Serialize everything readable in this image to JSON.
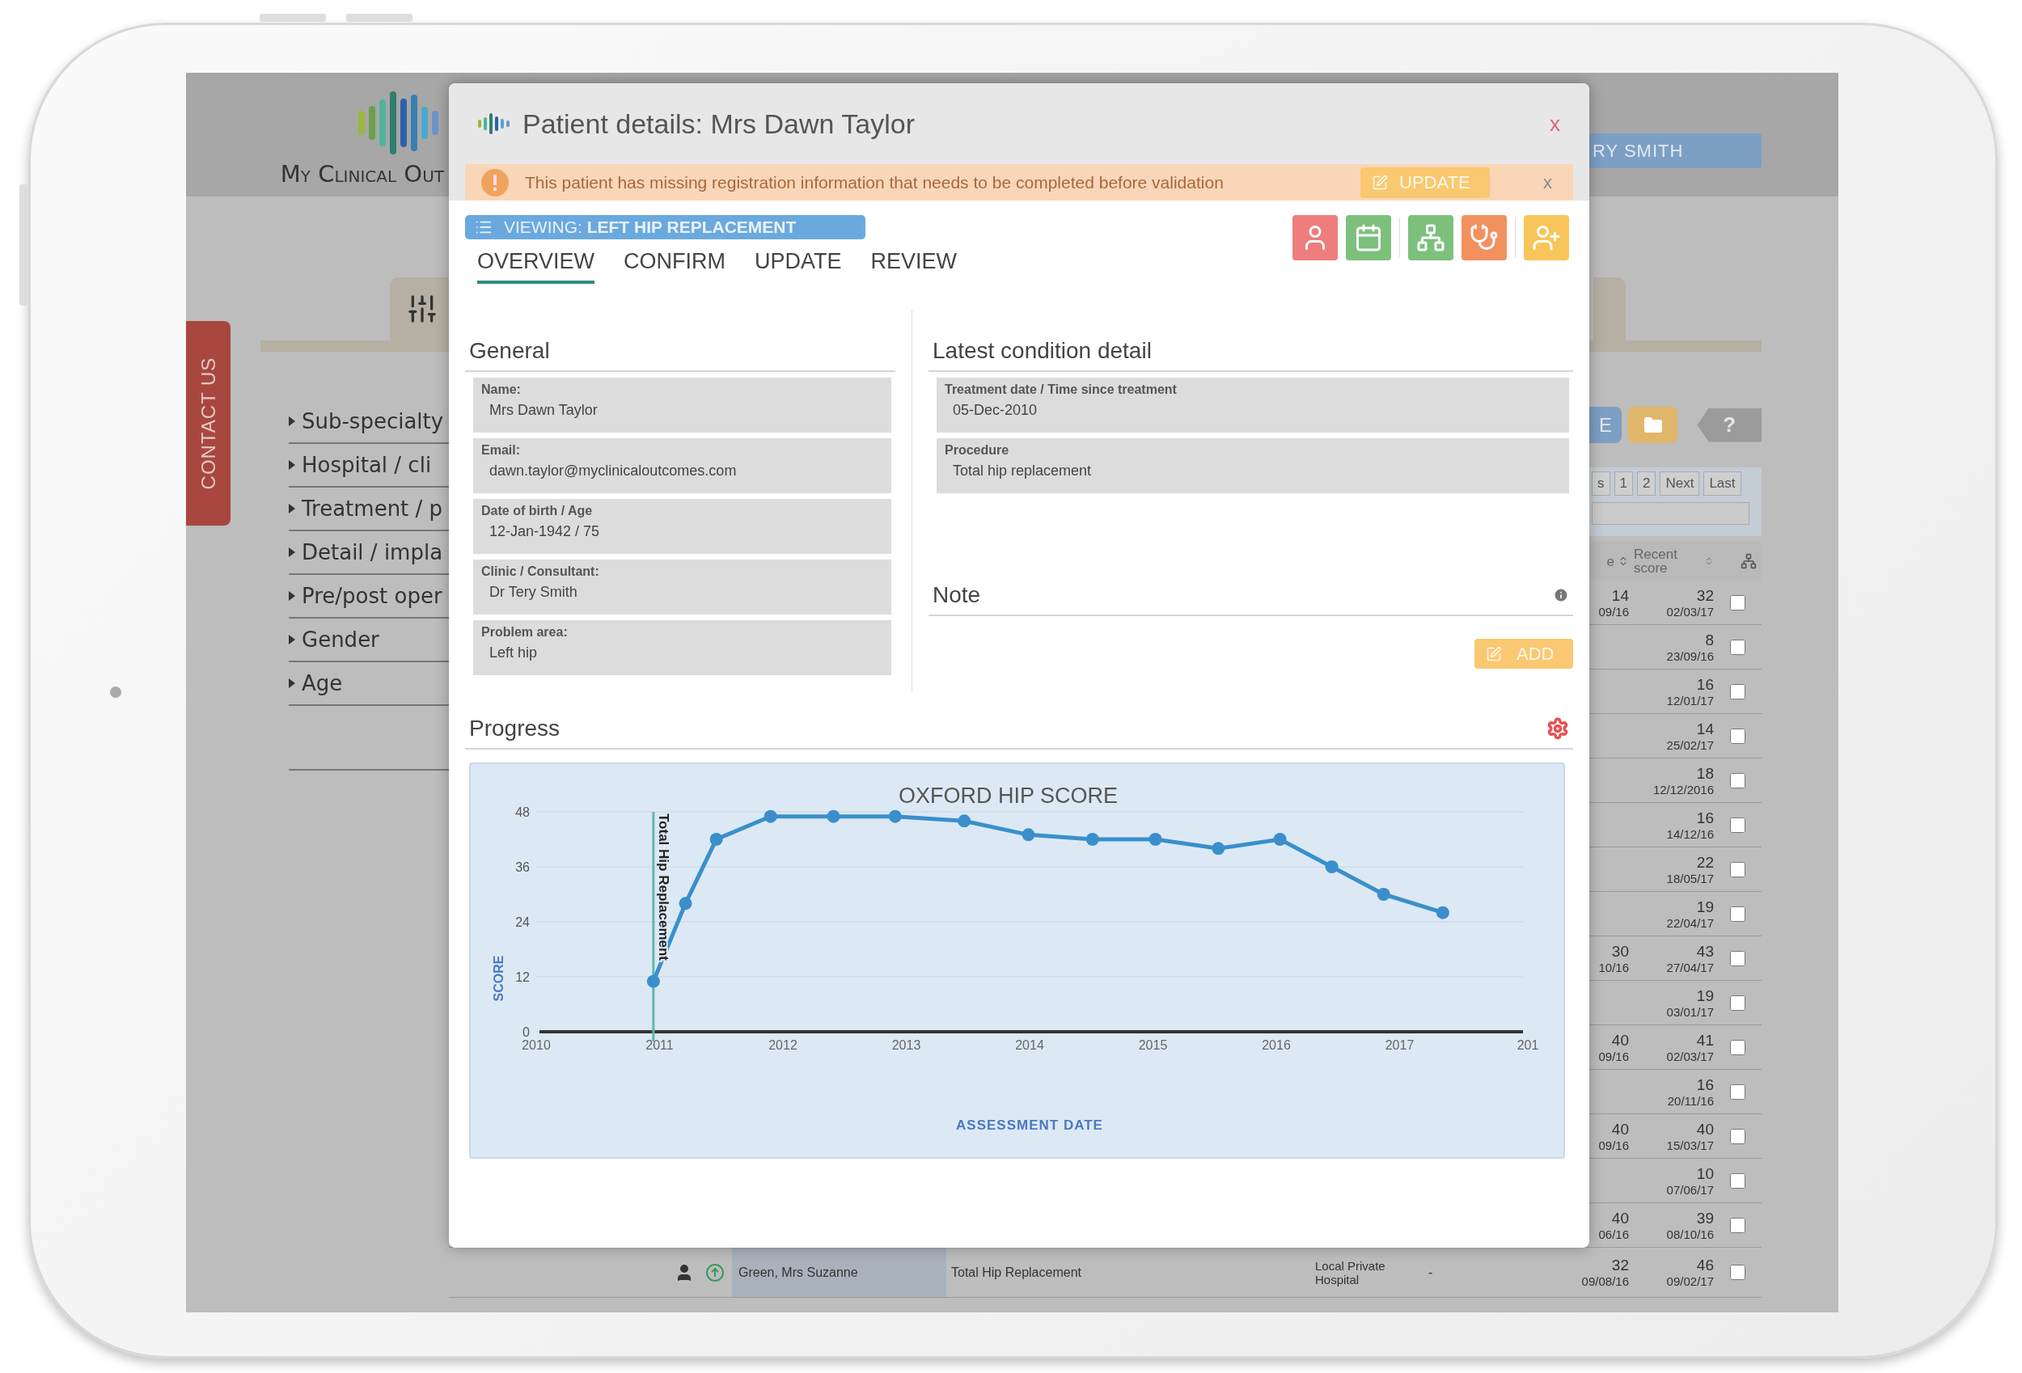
{
  "app": {
    "logo": "My Clinical Out",
    "user_button": "RY SMITH",
    "contact_tab": "CONTACT US",
    "filters": [
      "Sub-specialty",
      "Hospital / cli",
      "Treatment / p",
      "Detail / impla",
      "Pre/post oper",
      "Gender",
      "Age"
    ],
    "toolbar": {
      "list_button": "E",
      "help_button": "?"
    },
    "pagination": [
      "s",
      "1",
      "2",
      "Next",
      "Last"
    ],
    "table": {
      "columns": [
        "e",
        "Recent score"
      ],
      "rows": [
        {
          "column_a": {
            "score": "14",
            "date": "09/16"
          },
          "recent": {
            "score": "32",
            "date": "02/03/17"
          },
          "checked": false
        },
        {
          "recent": {
            "score": "8",
            "date": "23/09/16"
          },
          "checked": false
        },
        {
          "recent": {
            "score": "16",
            "date": "12/01/17"
          },
          "checked": false
        },
        {
          "recent": {
            "score": "14",
            "date": "25/02/17"
          },
          "checked": false
        },
        {
          "recent": {
            "score": "18",
            "date": "12/12/2016"
          },
          "checked": false
        },
        {
          "recent": {
            "score": "16",
            "date": "14/12/16"
          },
          "checked": false
        },
        {
          "recent": {
            "score": "22",
            "date": "18/05/17"
          },
          "checked": false
        },
        {
          "recent": {
            "score": "19",
            "date": "22/04/17"
          },
          "checked": false
        },
        {
          "column_a": {
            "score": "30",
            "date": "10/16"
          },
          "recent": {
            "score": "43",
            "date": "27/04/17"
          },
          "checked": false
        },
        {
          "recent": {
            "score": "19",
            "date": "03/01/17"
          },
          "checked": false
        },
        {
          "column_a": {
            "score": "40",
            "date": "09/16"
          },
          "recent": {
            "score": "41",
            "date": "02/03/17"
          },
          "checked": false
        },
        {
          "recent": {
            "score": "16",
            "date": "20/11/16"
          },
          "checked": false
        },
        {
          "column_a": {
            "score": "40",
            "date": "09/16"
          },
          "recent": {
            "score": "40",
            "date": "15/03/17"
          },
          "checked": false
        },
        {
          "recent": {
            "score": "10",
            "date": "07/06/17"
          },
          "checked": false
        },
        {
          "column_a": {
            "score": "40",
            "date": "06/16"
          },
          "recent": {
            "score": "39",
            "date": "08/10/16"
          },
          "checked": false
        },
        {
          "name": "Green, Mrs Suzanne",
          "procedure": "Total Hip Replacement",
          "hospital": "Local Private Hospital",
          "column_5": "-",
          "column_a": {
            "score": "32",
            "date": "09/08/16"
          },
          "recent": {
            "score": "46",
            "date": "09/02/17"
          },
          "checked": false
        }
      ]
    }
  },
  "modal": {
    "title": "Patient details: Mrs Dawn Taylor",
    "close": "x",
    "alert": {
      "message": "This patient has missing registration information that needs to be completed before validation",
      "button": "UPDATE",
      "close": "x"
    },
    "viewing": "VIEWING: **LEFT HIP REPLACEMENT**",
    "tabs": [
      {
        "label": "OVERVIEW",
        "selected": true
      },
      {
        "label": "CONFIRM",
        "selected": false
      },
      {
        "label": "UPDATE",
        "selected": false
      },
      {
        "label": "REVIEW",
        "selected": false
      }
    ],
    "general": {
      "title": "General",
      "fields": [
        {
          "label": "Name:",
          "value": "Mrs Dawn Taylor"
        },
        {
          "label": "Email:",
          "value": "dawn.taylor@myclinicaloutcomes.com"
        },
        {
          "label": "Date of birth / Age",
          "value": "12-Jan-1942 / 75"
        },
        {
          "label": "Clinic / Consultant:",
          "value": "Dr Tery Smith"
        },
        {
          "label": "Problem area:",
          "value": "Left hip"
        }
      ]
    },
    "condition": {
      "title": "Latest condition detail",
      "fields": [
        {
          "label": "Treatment date / Time since treatment",
          "value": "05-Dec-2010"
        },
        {
          "label": "Procedure",
          "value": "Total hip replacement"
        }
      ]
    },
    "note": {
      "title": "Note",
      "button": "ADD"
    },
    "progress": {
      "title": "Progress",
      "chart_data": {
        "type": "line",
        "title": "OXFORD HIP SCORE",
        "xlabel": "ASSESSMENT DATE",
        "ylabel": "SCORE",
        "x": [
          2010.95,
          2011.21,
          2011.46,
          2011.9,
          2012.41,
          2012.91,
          2013.47,
          2013.99,
          2014.51,
          2015.02,
          2015.53,
          2016.03,
          2016.45,
          2016.87,
          2017.35
        ],
        "series": [
          {
            "color": "#3a8fcb",
            "marker": "o",
            "values": [
              11,
              28,
              42,
              47,
              47,
              47,
              46,
              43,
              42,
              42,
              40,
              42,
              36,
              30,
              26
            ]
          }
        ],
        "grid": true,
        "xlim": [
          2010,
          2018
        ],
        "ylim": [
          0,
          48
        ],
        "xticks": [
          2010,
          2011,
          2012,
          2013,
          2014,
          2015,
          2016,
          2017
        ],
        "yticks": [
          0,
          12,
          24,
          36,
          48
        ],
        "ref_lines": [
          {
            "axis": "x",
            "value": 2010.95,
            "label": "Total Hip Replacement"
          }
        ]
      },
      "cut_tick_label": "201"
    }
  }
}
